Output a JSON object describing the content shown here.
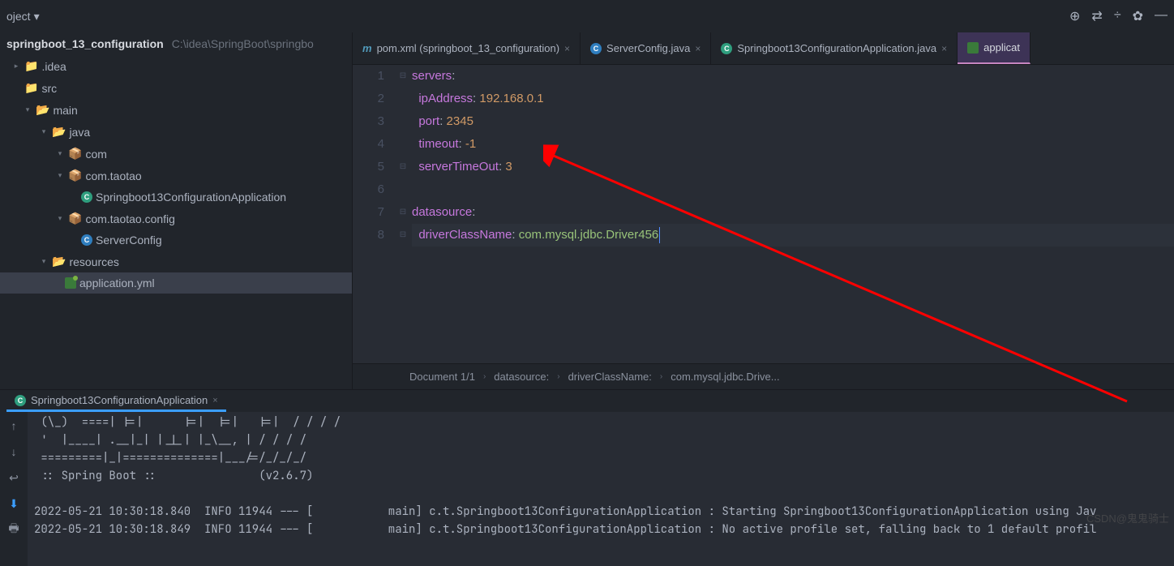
{
  "toolbar": {
    "project_dropdown": "oject"
  },
  "project": {
    "root_name": "springboot_13_configuration",
    "root_path": "C:\\idea\\SpringBoot\\springbo",
    "tree": {
      "idea": ".idea",
      "src": "src",
      "main": "main",
      "java": "java",
      "com": "com",
      "com_taotao": "com.taotao",
      "app_class": "Springboot13ConfigurationApplication",
      "config_pkg": "com.taotao.config",
      "server_config": "ServerConfig",
      "resources": "resources",
      "app_yml": "application.yml"
    }
  },
  "tabs": [
    {
      "label": "pom.xml (springboot_13_configuration)"
    },
    {
      "label": "ServerConfig.java"
    },
    {
      "label": "Springboot13ConfigurationApplication.java"
    },
    {
      "label": "applicat"
    }
  ],
  "code": {
    "lines": [
      {
        "n": "1",
        "key": "servers",
        "colon": ":",
        "val": ""
      },
      {
        "n": "2",
        "key": "  ipAddress",
        "colon": ":",
        "val": " 192.168.0.1"
      },
      {
        "n": "3",
        "key": "  port",
        "colon": ":",
        "val": " 2345"
      },
      {
        "n": "4",
        "key": "  timeout",
        "colon": ":",
        "val": " -1"
      },
      {
        "n": "5",
        "key": "  serverTimeOut",
        "colon": ":",
        "val": " 3"
      },
      {
        "n": "6",
        "key": "",
        "colon": "",
        "val": ""
      },
      {
        "n": "7",
        "key": "datasource",
        "colon": ":",
        "val": ""
      },
      {
        "n": "8",
        "key": "  driverClassName",
        "colon": ":",
        "val": " com.mysql.jdbc.Driver456"
      }
    ]
  },
  "breadcrumb": {
    "doc": "Document 1/1",
    "p1": "datasource:",
    "p2": "driverClassName:",
    "p3": "com.mysql.jdbc.Drive..."
  },
  "bottom_tab": "Springboot13ConfigurationApplication",
  "console": {
    "lines": [
      " (\\_)  ====| |=|      |=|  |=|   |=|  / / / /",
      " '  |____| .__|_| |_|_| |_\\__, | / / / /",
      " =========|_|==============|___/=/_/_/_/",
      " :: Spring Boot ::               (v2.6.7)",
      "",
      "2022-05-21 10:30:18.840  INFO 11944 --- [           main] c.t.Springboot13ConfigurationApplication : Starting Springboot13ConfigurationApplication using Jav",
      "2022-05-21 10:30:18.849  INFO 11944 --- [           main] c.t.Springboot13ConfigurationApplication : No active profile set, falling back to 1 default profil"
    ]
  },
  "watermark": "CSDN@鬼鬼骑士"
}
